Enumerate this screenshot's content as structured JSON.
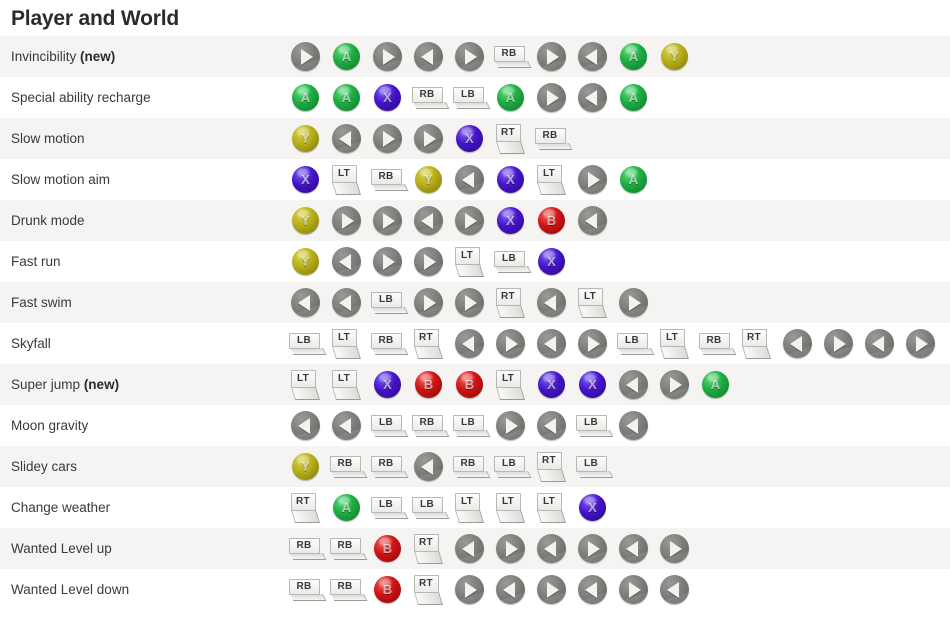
{
  "header": {
    "title": "Player and World"
  },
  "legend": {
    "button_names": {
      "A": "A",
      "B": "B",
      "X": "X",
      "Y": "Y",
      "LB": "LB",
      "RB": "RB",
      "LT": "LT",
      "RT": "RT",
      "left": "dpad-left",
      "right": "dpad-right"
    },
    "colors": {
      "A": "#1fae43",
      "B": "#cf1414",
      "X": "#4412c9",
      "Y": "#b5ad18",
      "dpad": "#7e7e7b",
      "shoulder": "#eceae7",
      "row_odd": "#f5f4f3",
      "row_even": "#ffffff",
      "title": "#2b2b2b",
      "label": "#3a3a3a"
    }
  },
  "table": {
    "rows": [
      {
        "name": "Invincibility",
        "tag": "(new)",
        "combo": [
          "right",
          "A",
          "right",
          "left",
          "right",
          "RB",
          "right",
          "left",
          "A",
          "Y"
        ]
      },
      {
        "name": "Special ability recharge",
        "tag": "",
        "combo": [
          "A",
          "A",
          "X",
          "RB",
          "LB",
          "A",
          "right",
          "left",
          "A"
        ]
      },
      {
        "name": "Slow motion",
        "tag": "",
        "combo": [
          "Y",
          "left",
          "right",
          "right",
          "X",
          "RT",
          "RB"
        ]
      },
      {
        "name": "Slow motion aim",
        "tag": "",
        "combo": [
          "X",
          "LT",
          "RB",
          "Y",
          "left",
          "X",
          "LT",
          "right",
          "A"
        ]
      },
      {
        "name": "Drunk mode",
        "tag": "",
        "combo": [
          "Y",
          "right",
          "right",
          "left",
          "right",
          "X",
          "B",
          "left"
        ]
      },
      {
        "name": "Fast run",
        "tag": "",
        "combo": [
          "Y",
          "left",
          "right",
          "right",
          "LT",
          "LB",
          "X"
        ]
      },
      {
        "name": "Fast swim",
        "tag": "",
        "combo": [
          "left",
          "left",
          "LB",
          "right",
          "right",
          "RT",
          "left",
          "LT",
          "right"
        ]
      },
      {
        "name": "Skyfall",
        "tag": "",
        "combo": [
          "LB",
          "LT",
          "RB",
          "RT",
          "left",
          "right",
          "left",
          "right",
          "LB",
          "LT",
          "RB",
          "RT",
          "left",
          "right",
          "left",
          "right"
        ]
      },
      {
        "name": "Super jump",
        "tag": "(new)",
        "combo": [
          "LT",
          "LT",
          "X",
          "B",
          "B",
          "LT",
          "X",
          "X",
          "left",
          "right",
          "A"
        ]
      },
      {
        "name": "Moon gravity",
        "tag": "",
        "combo": [
          "left",
          "left",
          "LB",
          "RB",
          "LB",
          "right",
          "left",
          "LB",
          "left"
        ]
      },
      {
        "name": "Slidey cars",
        "tag": "",
        "combo": [
          "Y",
          "RB",
          "RB",
          "left",
          "RB",
          "LB",
          "RT",
          "LB"
        ]
      },
      {
        "name": "Change weather",
        "tag": "",
        "combo": [
          "RT",
          "A",
          "LB",
          "LB",
          "LT",
          "LT",
          "LT",
          "X"
        ]
      },
      {
        "name": "Wanted Level up",
        "tag": "",
        "combo": [
          "RB",
          "RB",
          "B",
          "RT",
          "left",
          "right",
          "left",
          "right",
          "left",
          "right"
        ]
      },
      {
        "name": "Wanted Level down",
        "tag": "",
        "combo": [
          "RB",
          "RB",
          "B",
          "RT",
          "right",
          "left",
          "right",
          "left",
          "right",
          "left"
        ]
      }
    ]
  }
}
